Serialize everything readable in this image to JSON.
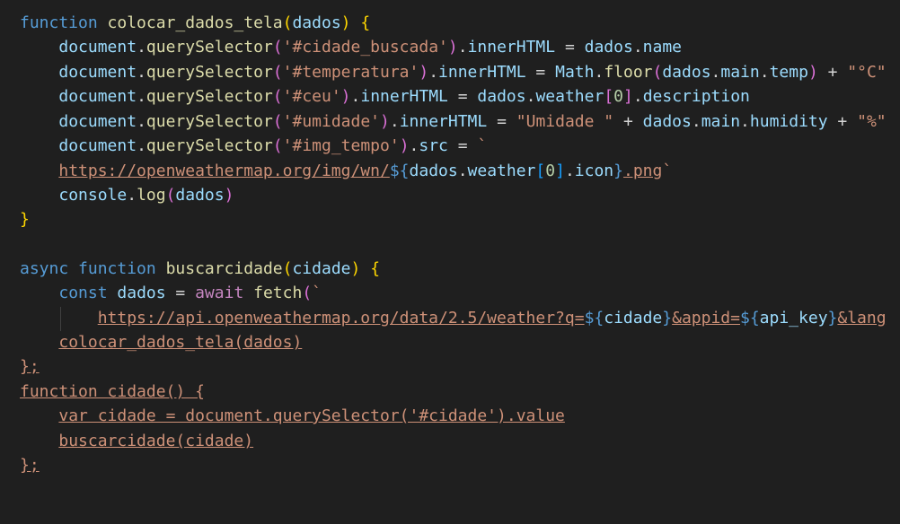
{
  "code_lines": [
    "function colocar_dados_tela(dados) {",
    "    document.querySelector('#cidade_buscada').innerHTML = dados.name",
    "    document.querySelector('#temperatura').innerHTML = Math.floor(dados.main.temp) + \"°C\"",
    "    document.querySelector('#ceu').innerHTML = dados.weather[0].description",
    "    document.querySelector('#umidade').innerHTML = \"Umidade \" + dados.main.humidity + \"%\"",
    "    document.querySelector('#img_tempo').src = `",
    "    https://openweathermap.org/img/wn/${dados.weather[0].icon}.png`",
    "    console.log(dados)",
    "}",
    "",
    "async function buscarcidade(cidade) {",
    "    const dados = await fetch(`",
    "        https://api.openweathermap.org/data/2.5/weather?q=${cidade}&appid=${api_key}&lang",
    "    colocar_dados_tela(dados)",
    "};",
    "function cidade() {",
    "    var cidade = document.querySelector('#cidade').value",
    "    buscarcidade(cidade)",
    "};"
  ],
  "colors": {
    "background": "#1f1f1f",
    "keyword": "#569cd6",
    "control_keyword": "#c586c0",
    "function_name": "#dcdcaa",
    "variable": "#9cdcfe",
    "string": "#ce9178",
    "number": "#b5cea8",
    "bracket_level1": "#ffd700",
    "bracket_level2": "#da70d6",
    "bracket_level3": "#179fff"
  }
}
